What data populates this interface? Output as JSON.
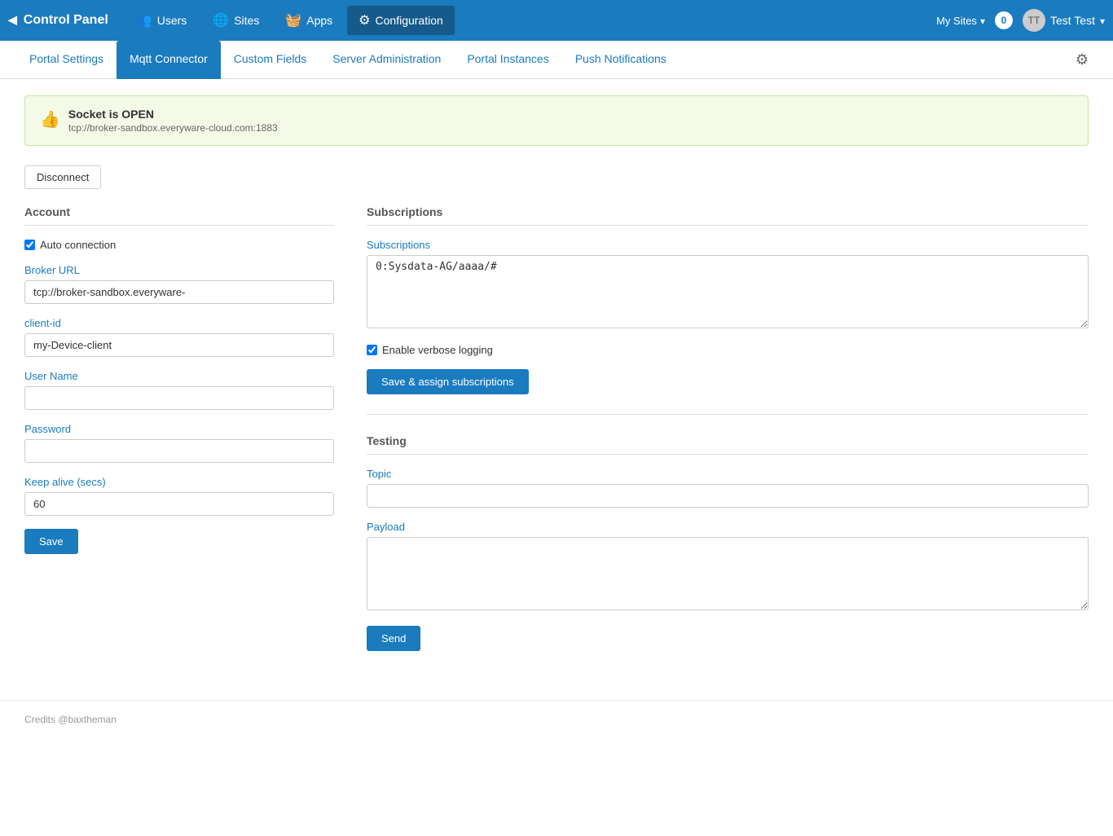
{
  "topNav": {
    "brand": "Control Panel",
    "back_icon": "back-icon",
    "items": [
      {
        "label": "Users",
        "icon": "users-icon",
        "active": false
      },
      {
        "label": "Sites",
        "icon": "sites-icon",
        "active": false
      },
      {
        "label": "Apps",
        "icon": "apps-icon",
        "active": false
      },
      {
        "label": "Configuration",
        "icon": "config-icon",
        "active": true
      }
    ],
    "mySites": "My Sites",
    "badge": "0",
    "userName": "Test Test"
  },
  "subNav": {
    "tabs": [
      {
        "label": "Portal Settings",
        "active": false
      },
      {
        "label": "Mqtt Connector",
        "active": true
      },
      {
        "label": "Custom Fields",
        "active": false
      },
      {
        "label": "Server Administration",
        "active": false
      },
      {
        "label": "Portal Instances",
        "active": false
      },
      {
        "label": "Push Notifications",
        "active": false
      }
    ]
  },
  "alert": {
    "status": "Socket is OPEN",
    "url": "tcp://broker-sandbox.everyware-cloud.com:1883"
  },
  "buttons": {
    "disconnect": "Disconnect",
    "save": "Save",
    "saveAssign": "Save & assign subscriptions",
    "send": "Send"
  },
  "account": {
    "sectionLabel": "Account",
    "autoConnectionLabel": "Auto connection",
    "brokerUrlLabel": "Broker URL",
    "brokerUrlValue": "tcp://broker-sandbox.everyware-",
    "clientIdLabel": "client-id",
    "clientIdValue": "my-Device-client",
    "userNameLabel": "User Name",
    "userNameValue": "",
    "passwordLabel": "Password",
    "passwordValue": "",
    "keepAliveLabel": "Keep alive (secs)",
    "keepAliveValue": "60"
  },
  "subscriptions": {
    "sectionLabel": "Subscriptions",
    "subscriptionsLabel": "Subscriptions",
    "subscriptionsValue": "0:Sysdata-AG/aaaa/#",
    "verboseLoggingLabel": "Enable verbose logging"
  },
  "testing": {
    "sectionLabel": "Testing",
    "topicLabel": "Topic",
    "topicValue": "",
    "payloadLabel": "Payload",
    "payloadValue": ""
  },
  "footer": {
    "credits": "Credits @baxtheman"
  }
}
